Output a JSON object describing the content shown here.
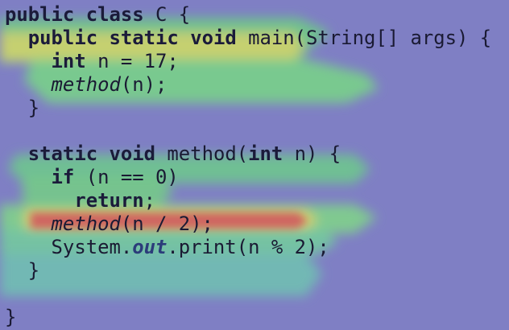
{
  "colors": {
    "background": "#7f7fc4",
    "heat_green": "#7ccf8f",
    "heat_yellow": "#d8d46a",
    "heat_red": "#d26a6a",
    "heat_teal": "#6ec7b4",
    "text": "#1a1a33"
  },
  "code": {
    "line1": {
      "kw1": "public",
      "kw2": "class",
      "rest": " C {"
    },
    "line2": {
      "indent": "  ",
      "kw1": "public",
      "kw2": "static",
      "kw3": "void",
      "rest": " main(String[] args) {"
    },
    "line3": {
      "indent": "    ",
      "kw1": "int",
      "rest": " n = 17;"
    },
    "line4": {
      "indent": "    ",
      "call": "method",
      "rest": "(n);"
    },
    "line5": {
      "text": "  }"
    },
    "line6": {
      "text": ""
    },
    "line7": {
      "indent": "  ",
      "kw1": "static",
      "kw2": "void",
      "mid": " method(",
      "kw3": "int",
      "rest": " n) {"
    },
    "line8": {
      "indent": "    ",
      "kw1": "if",
      "rest": " (n == 0)"
    },
    "line9": {
      "indent": "      ",
      "kw1": "return",
      "rest": ";"
    },
    "line10": {
      "indent": "    ",
      "call": "method",
      "rest": "(n / 2);"
    },
    "line11": {
      "indent": "    ",
      "pre": "System.",
      "field": "out",
      "rest": ".print(n % 2);"
    },
    "line12": {
      "text": "  }"
    },
    "line13": {
      "text": ""
    },
    "line14": {
      "text": "}"
    }
  },
  "heatmap": {
    "description_levels": [
      "green",
      "yellow",
      "red"
    ]
  }
}
